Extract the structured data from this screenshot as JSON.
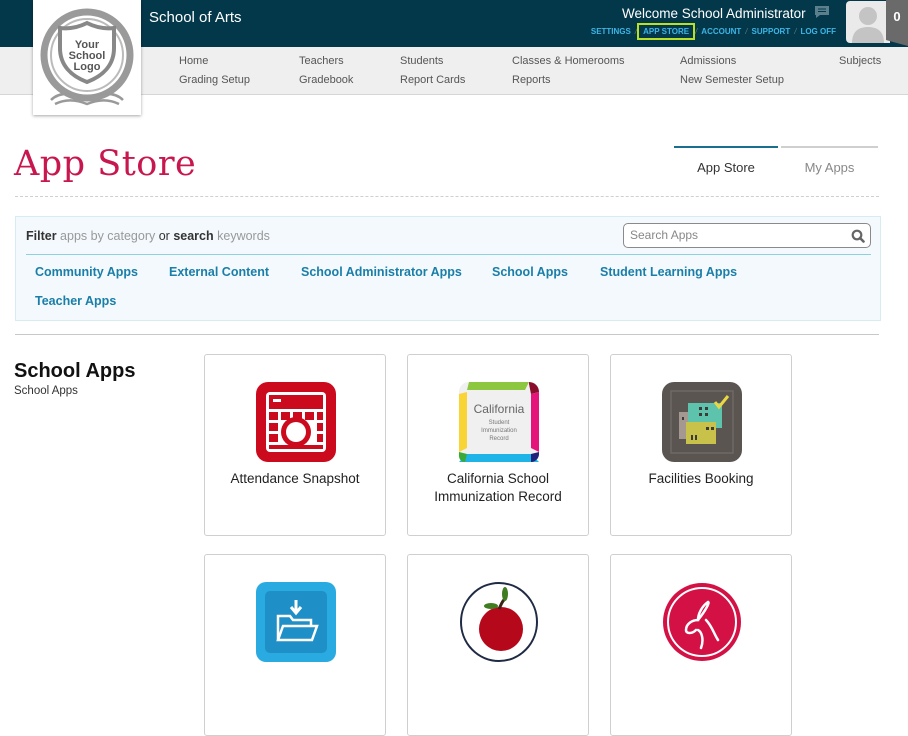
{
  "header": {
    "school_name": "School of Arts",
    "welcome": "Welcome School Administrator",
    "links": [
      "SETTINGS",
      "APP STORE",
      "ACCOUNT",
      "SUPPORT",
      "LOG OFF"
    ],
    "active_link": "APP STORE",
    "notification_count": "0",
    "logo_text": [
      "Your",
      "School",
      "Logo"
    ]
  },
  "nav": {
    "row1": [
      "Home",
      "Teachers",
      "Students",
      "Classes & Homerooms",
      "Admissions",
      "Subjects"
    ],
    "row2": [
      "Grading Setup",
      "Gradebook",
      "Report Cards",
      "Reports",
      "New Semester Setup"
    ]
  },
  "page": {
    "title": "App Store",
    "tabs": [
      "App Store",
      "My Apps"
    ],
    "active_tab": "App Store"
  },
  "filter": {
    "w1": "Filter",
    "w2": " apps by category ",
    "w3": "or",
    "w4": "search",
    "w5": " keywords",
    "search_placeholder": "Search Apps",
    "categories": [
      "Community Apps",
      "External Content",
      "School Administrator Apps",
      "School Apps",
      "Student Learning Apps",
      "Teacher Apps"
    ]
  },
  "section": {
    "title": "School Apps",
    "subtitle": "School Apps",
    "apps": [
      {
        "name": "Attendance Snapshot",
        "icon": "attendance-calendar-icon",
        "color": "#cc0a1d"
      },
      {
        "name": "California School Immunization Record",
        "icon": "immunization-record-icon",
        "color": "#8dc63f"
      },
      {
        "name": "Facilities Booking",
        "icon": "facilities-building-icon",
        "color": "#5a5551"
      },
      {
        "name": "",
        "icon": "folder-download-icon",
        "color": "#29abe2"
      },
      {
        "name": "",
        "icon": "apple-icon",
        "color": "#b5081b"
      },
      {
        "name": "",
        "icon": "rabbit-icon",
        "color": "#d31145"
      }
    ]
  }
}
